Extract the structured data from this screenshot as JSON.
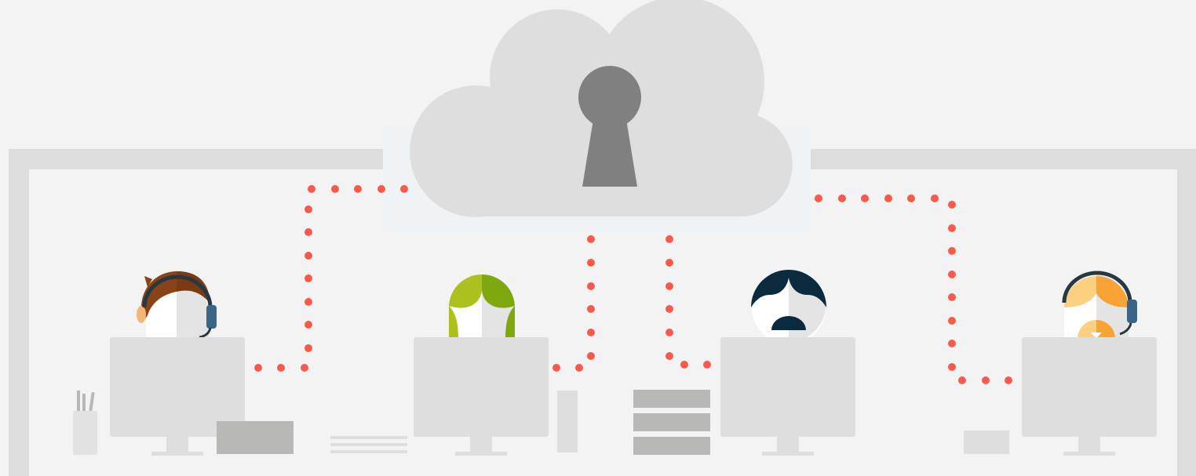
{
  "scene": {
    "description_items": [],
    "colors": {
      "background": "#f3f3f3",
      "frame": "#dcdcdc",
      "cloud": "#dedede",
      "keyhole": "#808080",
      "connection_dots": "#f75a4a",
      "monitor": "#dedede",
      "accessory": "#b8b8b7"
    },
    "icons": [
      "cloud-icon",
      "keyhole-icon",
      "person-brown-hair-headset-icon",
      "person-green-hair-icon",
      "person-dark-hair-mustache-icon",
      "person-orange-hair-headset-icon",
      "monitor-icon",
      "pen-holder-icon",
      "papers-icon",
      "server-stack-icon",
      "pc-tower-icon"
    ]
  }
}
